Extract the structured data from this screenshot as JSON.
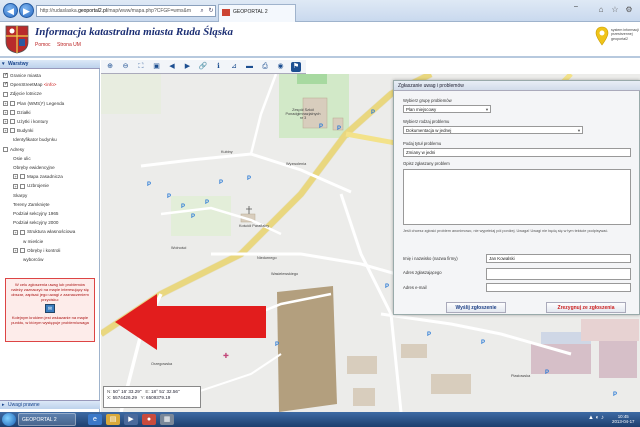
{
  "browser": {
    "url_prefix": "http://rudaslaska.",
    "url_host": "geoportal2.pl",
    "url_rest": "/map/www/mapa.php?CFGF=wms&m",
    "tab_title": "GEOPORTAL 2",
    "back_icon": "back-arrow-icon",
    "forward_icon": "forward-arrow-icon"
  },
  "header": {
    "title": "Informacja katastralna miasta Ruda Śląska",
    "help": "Pomoc",
    "city_link": "Strona UM",
    "logo_text": "system informacji przestrzennej geoportal2"
  },
  "left_panel": {
    "layers_title": "Warstwy",
    "remarks_title": "Uwagi prawne",
    "layers": [
      {
        "label": "Granice miasta",
        "checked": true,
        "expander": false,
        "indent": 0
      },
      {
        "label": "OpenStreetMap",
        "suffix": " <info>",
        "checked": true,
        "expander": false,
        "indent": 0
      },
      {
        "label": "Zdjęcie lotnicze",
        "checked": false,
        "expander": false,
        "indent": 0
      },
      {
        "label": "Plan (WMS)*) Legenda",
        "checked": false,
        "expander": true,
        "indent": 0
      },
      {
        "label": "Działki",
        "checked": false,
        "expander": true,
        "indent": 0
      },
      {
        "label": "Użytki i kontury",
        "checked": false,
        "expander": true,
        "indent": 0
      },
      {
        "label": "Budynki",
        "checked": false,
        "expander": true,
        "indent": 0
      },
      {
        "label": "Identyfikator budynku",
        "checked": false,
        "expander": false,
        "indent": 1
      },
      {
        "label": "Adresy",
        "checked": false,
        "expander": false,
        "indent": 0
      },
      {
        "label": "Osie ulic",
        "checked": false,
        "expander": false,
        "indent": 1
      },
      {
        "label": "Obręby ewidencyjne",
        "checked": false,
        "expander": false,
        "indent": 1
      },
      {
        "label": "Mapa zasadnicza",
        "checked": false,
        "expander": true,
        "indent": 1
      },
      {
        "label": "Uzbrojenie",
        "checked": false,
        "expander": true,
        "indent": 1
      },
      {
        "label": "Skarpy",
        "checked": false,
        "expander": false,
        "indent": 1
      },
      {
        "label": "Tereny Zamknięte",
        "checked": false,
        "expander": false,
        "indent": 1
      },
      {
        "label": "Podział sekcyjny 1965",
        "checked": false,
        "expander": false,
        "indent": 1
      },
      {
        "label": "Podział sekcyjny 2000",
        "checked": false,
        "expander": false,
        "indent": 1
      },
      {
        "label": "Struktura własnościowa",
        "checked": false,
        "expander": true,
        "indent": 1
      },
      {
        "label": "w mieście",
        "checked": false,
        "expander": false,
        "indent": 2
      },
      {
        "label": "Obręby i kontroli",
        "checked": false,
        "expander": true,
        "indent": 1
      },
      {
        "label": "wyborców",
        "checked": false,
        "expander": false,
        "indent": 2
      }
    ],
    "info_box_top": "W celu zgłoszenia uwag lub problemów należy zaznaczyć na mapie interesujący się obszar, zapisać jego uwagi z zaznaczeniem przycisku:",
    "info_box_bottom": "Kolejnym krokiem jest wskazanie na mapie punktu, w którym występuje problem/uwaga"
  },
  "toolbar": {
    "tools": [
      "zoom-in-icon",
      "zoom-out-icon",
      "zoom-extent-icon",
      "zoom-box-icon",
      "pan-left-icon",
      "pan-right-icon",
      "link-icon",
      "info-icon",
      "measure-icon",
      "ruler-icon",
      "print-icon",
      "camera-icon",
      "report-problem-icon"
    ]
  },
  "map": {
    "labels": [
      "Zespół Szkół Ponadgimnazjalnych nr 3",
      "Kościół Parafialny",
      "Kubiny",
      "Wyzwolenia",
      "Niedurnego",
      "Wolności",
      "Wasielewskiego",
      "Orzegowska",
      "Piastowska"
    ],
    "coords": {
      "n_label": "N:",
      "n": "50° 16' 33.29\"",
      "e_label": "E:",
      "e": "18° 51' 32.56\"",
      "x_label": "X:",
      "x": "5574426.29",
      "y_label": "Y:",
      "y": "6509379.19"
    }
  },
  "dialog": {
    "title": "Zgłaszanie uwag i problemów",
    "group_label": "Wybierz grupę problemów",
    "group_value": "Plan miejscowy",
    "type_label": "Wybierz rodzaj problemu",
    "type_value": "Dokumentacja w jednej",
    "subject_label": "Podaj tytuł problemu",
    "subject_value": "Zmiany w jedni",
    "desc_label": "Opisz zgłaszany problem",
    "note": "Jeśli chcesz zgłosić problem anonimowo, nie wypełniaj pól poniżej. Uwaga! Uwagi nie będą się w tym tekście podpisywać.",
    "name_label": "Imię i nazwisko (nazwa firmy)",
    "name_value": "Jan Kowalski",
    "address_label": "Adres zgłaszającego",
    "email_label": "Adres e-mail",
    "send_label": "Wyślij zgłoszenie",
    "cancel_label": "Zrezygnuj ze zgłoszenia"
  },
  "taskbar": {
    "task_label": "GEOPORTAL 2",
    "time": "10:45",
    "date": "2013-04-17"
  }
}
